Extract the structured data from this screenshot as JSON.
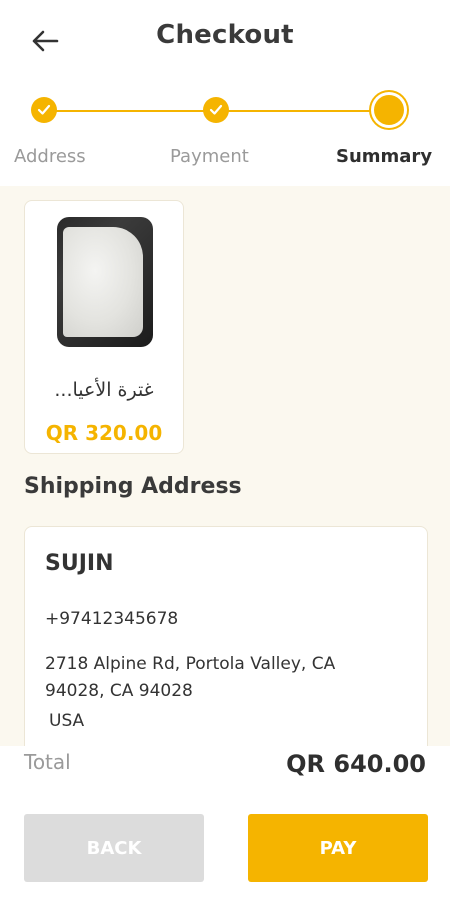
{
  "header": {
    "title": "Checkout",
    "back_icon": "arrow-left-icon"
  },
  "stepper": {
    "steps": [
      {
        "label": "Address",
        "state": "done"
      },
      {
        "label": "Payment",
        "state": "done"
      },
      {
        "label": "Summary",
        "state": "current"
      }
    ],
    "accent_color": "#f5b400"
  },
  "product": {
    "name": "غترة الأعيا...",
    "price": "QR 320.00"
  },
  "shipping": {
    "section_title": "Shipping Address",
    "name": "SUJIN",
    "phone": "+97412345678",
    "address_line": "2718 Alpine Rd, Portola Valley, CA 94028,  CA 94028",
    "country": "USA"
  },
  "summary": {
    "total_label": "Total",
    "total_value": "QR 640.00"
  },
  "actions": {
    "back_label": "BACK",
    "pay_label": "PAY"
  }
}
